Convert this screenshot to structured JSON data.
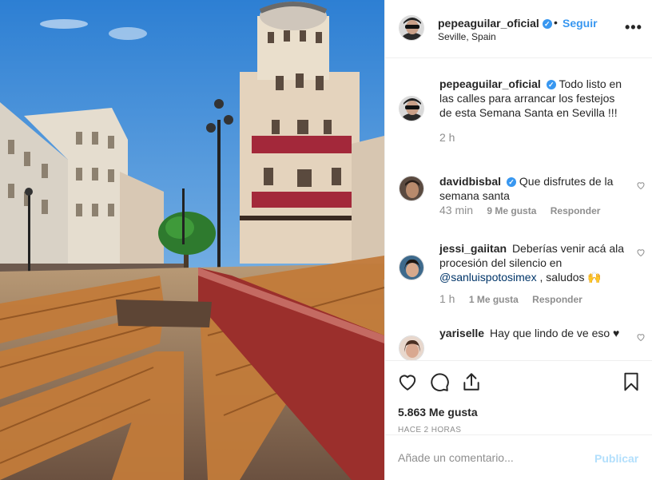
{
  "post": {
    "username": "pepeaguilar_oficial",
    "follow_label": "Seguir",
    "location": "Seville, Spain",
    "more_label": "•••",
    "separator": "•"
  },
  "comments": [
    {
      "username": "pepeaguilar_oficial",
      "text": "Todo listo en las calles para arrancar los festejos de esta Semana Santa en Sevilla !!!",
      "time": "2 h"
    },
    {
      "username": "davidbisbal",
      "text": "Que disfrutes de la semana santa",
      "time": "43 min",
      "likes": "9 Me gusta",
      "reply": "Responder"
    },
    {
      "username": "jessi_gaiitan",
      "text_before": "Deberías venir acá ala procesión del silencio en",
      "mention": "@sanluispotosimex",
      "text_after": ", saludos 🙌",
      "time": "1 h",
      "likes": "1 Me gusta",
      "reply": "Responder"
    },
    {
      "username": "yariselle",
      "text": "Hay que lindo de ve eso ♥"
    }
  ],
  "footer": {
    "likes": "5.863 Me gusta",
    "posted": "HACE 2 HORAS",
    "comment_placeholder": "Añade un comentario...",
    "publish_label": "Publicar"
  },
  "colors": {
    "link_blue": "#3897f0",
    "muted": "#8e8e8e",
    "publish_disabled": "#b2dffc"
  }
}
